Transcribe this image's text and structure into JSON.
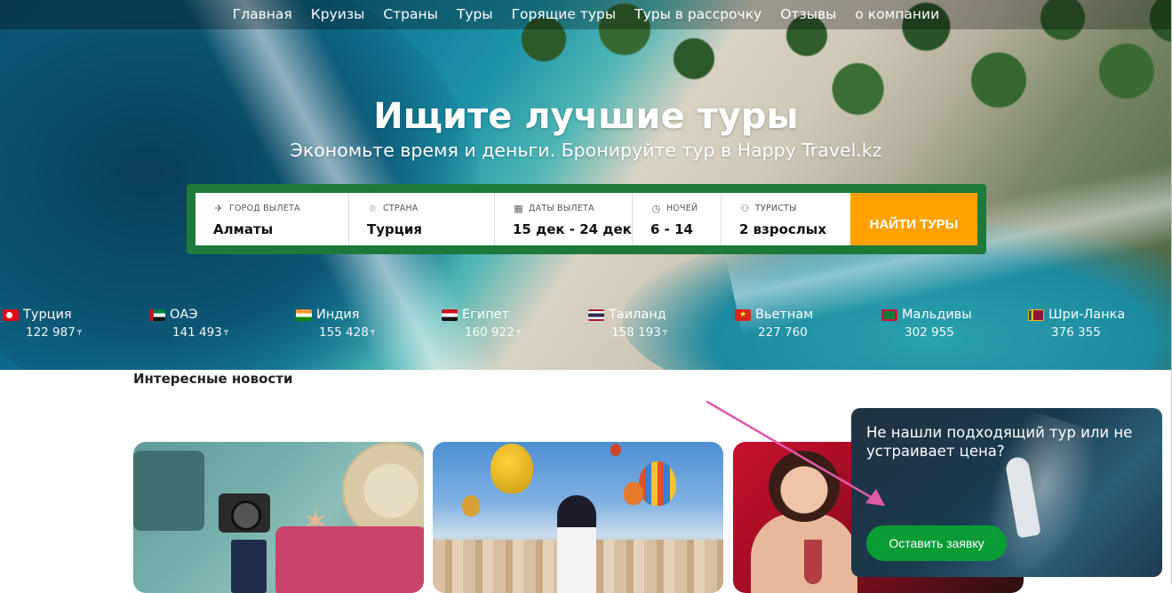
{
  "nav": {
    "items": [
      {
        "label": "Главная"
      },
      {
        "label": "Круизы"
      },
      {
        "label": "Страны"
      },
      {
        "label": "Туры"
      },
      {
        "label": "Горящие туры"
      },
      {
        "label": "Туры в рассрочку"
      },
      {
        "label": "Отзывы"
      },
      {
        "label": "о компании"
      }
    ]
  },
  "hero": {
    "title": "Ищите лучшие туры",
    "subtitle": "Экономьте время и деньги. Бронируйте тур в Happy Travel.kz"
  },
  "search": {
    "departure_label": "Город вылета",
    "departure_value": "Алматы",
    "country_label": "Страна",
    "country_value": "Турция",
    "dates_label": "Даты вылета",
    "dates_value": "15 дек - 24 дек",
    "nights_label": "Ночей",
    "nights_value": "6 - 14",
    "tourists_label": "Туристы",
    "tourists_value": "2 взрослых",
    "find_button": "НАЙТИ ТУРЫ",
    "colors": {
      "frame": "#1d7a3a",
      "button": "#ffa200"
    }
  },
  "countries": [
    {
      "name": "Турция",
      "price": "122 987",
      "currency": "₸",
      "flag": "turkey-flag"
    },
    {
      "name": "ОАЭ",
      "price": "141 493",
      "currency": "₸",
      "flag": "uae-flag"
    },
    {
      "name": "Индия",
      "price": "155 428",
      "currency": "₸",
      "flag": "india-flag"
    },
    {
      "name": "Египет",
      "price": "160 922",
      "currency": "₸",
      "flag": "egypt-flag"
    },
    {
      "name": "Таиланд",
      "price": "158 193",
      "currency": "₸",
      "flag": "thailand-flag"
    },
    {
      "name": "Вьетнам",
      "price": "227 760",
      "currency": "",
      "flag": "vietnam-flag"
    },
    {
      "name": "Мальдивы",
      "price": "302 955",
      "currency": "",
      "flag": "maldives-flag"
    },
    {
      "name": "Шри-Ланка",
      "price": "376 355",
      "currency": "",
      "flag": "sri-lanka-flag"
    }
  ],
  "news": {
    "title": "Интересные новости"
  },
  "popup": {
    "text": "Не нашли подходящий тур или не устраивает цена?",
    "button": "Оставить заявку",
    "button_color": "#0a9c34"
  },
  "annotation_arrow_color": "#e05aa8"
}
